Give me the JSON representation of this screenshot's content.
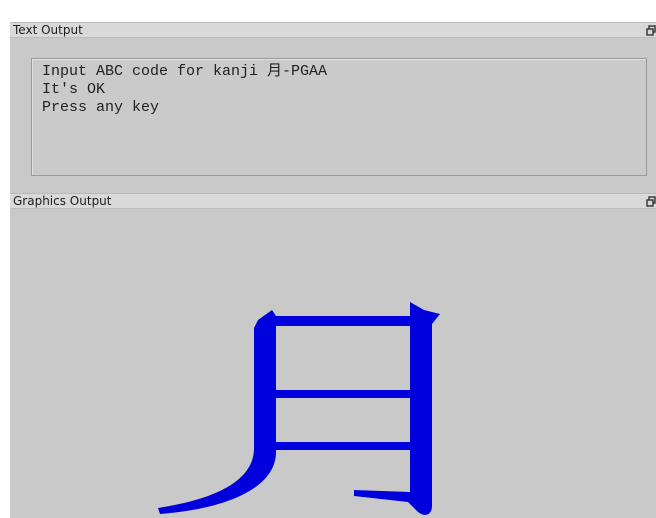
{
  "text_panel": {
    "title": "Text Output",
    "lines": [
      "Input ABC code for kanji 月-PGAA",
      "It's OK",
      "Press any key"
    ]
  },
  "graphics_panel": {
    "title": "Graphics Output",
    "kanji_color": "#0000dd"
  },
  "icons": {
    "restore": "restore-window-icon"
  }
}
